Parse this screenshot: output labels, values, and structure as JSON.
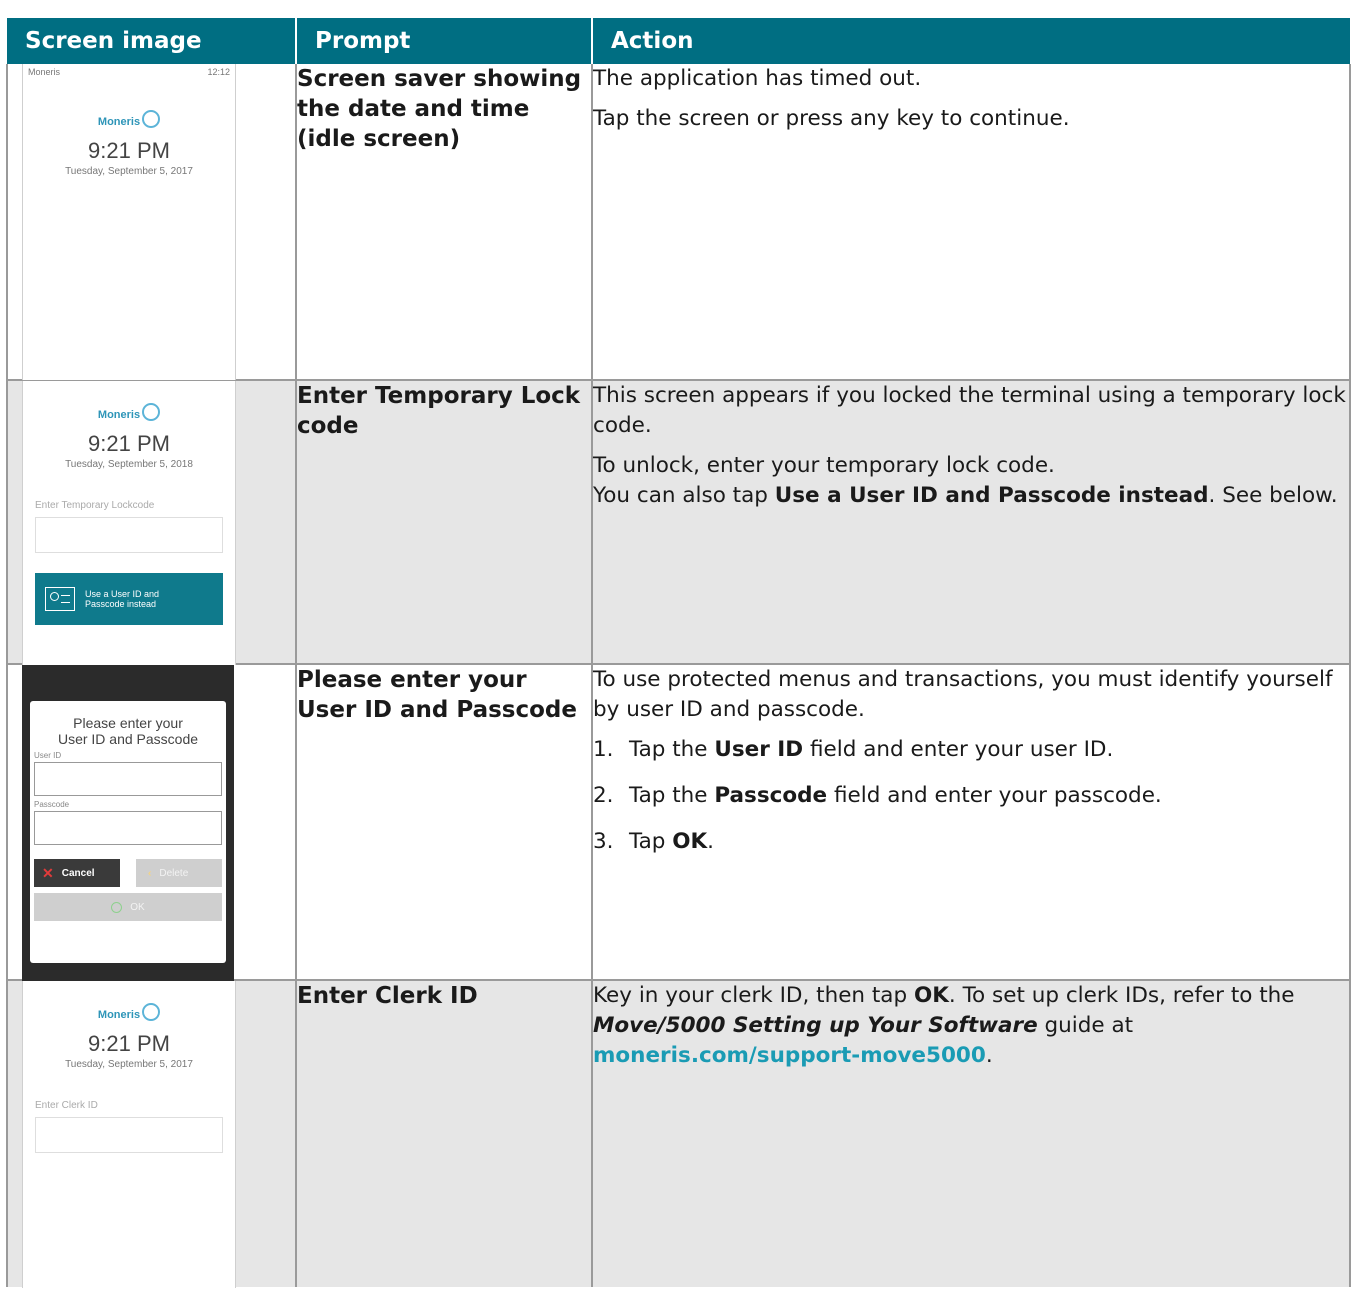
{
  "table": {
    "headers": [
      "Screen image",
      "Prompt",
      "Action"
    ]
  },
  "rows": [
    {
      "prompt": "Screen saver showing the date and time (idle screen)",
      "action_p1": "The application has timed out.",
      "action_p2": "Tap the screen or press any key to continue.",
      "screen": {
        "status_left": "Moneris",
        "status_right": "12:12",
        "logo": "Moneris",
        "time": "9:21 PM",
        "date": "Tuesday, September 5, 2017"
      }
    },
    {
      "prompt": "Enter Temporary Lock code",
      "action_p1": "This screen appears if you locked the terminal using a temporary lock code.",
      "action_p2": "To unlock, enter your temporary lock code.",
      "action_p3_pre": "You can also tap ",
      "action_p3_bold": "Use a User ID and Passcode instead",
      "action_p3_post": ". See below.",
      "screen": {
        "logo": "Moneris",
        "time": "9:21 PM",
        "date": "Tuesday, September 5, 2018",
        "field_label": "Enter Temporary Lockcode",
        "button_line1": "Use a User ID and",
        "button_line2": "Passcode instead"
      }
    },
    {
      "prompt": "Please enter your User ID and Passcode",
      "action_p1": "To use protected menus and transactions, you must identify yourself by user ID and passcode.",
      "steps": [
        {
          "num": "1.",
          "pre": "Tap the ",
          "bold": "User ID",
          "post": " field and enter your user ID."
        },
        {
          "num": "2.",
          "pre": "Tap the ",
          "bold": "Passcode",
          "post": " field and enter your passcode."
        },
        {
          "num": "3.",
          "pre": "Tap ",
          "bold": "OK",
          "post": "."
        }
      ],
      "screen": {
        "title_line1": "Please enter your",
        "title_line2": "User ID and Passcode",
        "user_label": "User ID",
        "pass_label": "Passcode",
        "cancel": "Cancel",
        "delete": "Delete",
        "ok": "OK"
      }
    },
    {
      "prompt": "Enter Clerk ID",
      "action_pre": "Key in your clerk ID, then tap ",
      "action_ok": "OK",
      "action_mid": ". To set up clerk IDs, refer to the ",
      "action_guide": "Move/5000 Setting up Your Software",
      "action_mid2": " guide at ",
      "action_link": "moneris.com/support-move5000",
      "action_end": ".",
      "screen": {
        "logo": "Moneris",
        "time": "9:21 PM",
        "date": "Tuesday, September 5, 2017",
        "field_label": "Enter Clerk ID"
      }
    }
  ],
  "colors": {
    "header_bg": "#006e82",
    "row_shade": "#e6e6e6",
    "link": "#1a9bb4"
  }
}
